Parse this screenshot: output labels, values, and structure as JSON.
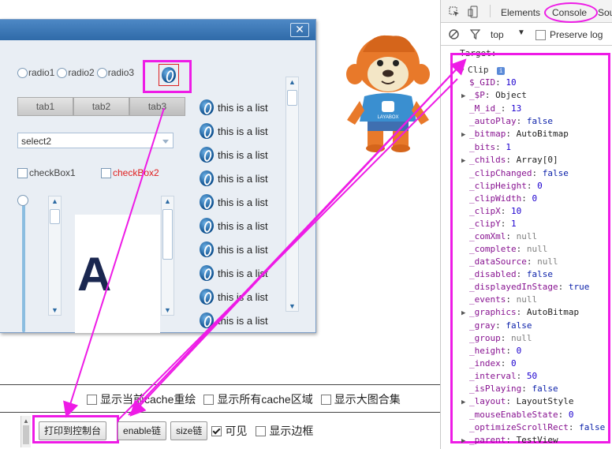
{
  "window": {
    "close_label": "✕"
  },
  "radios": [
    "radio1",
    "radio2",
    "radio3"
  ],
  "tabs": [
    "tab1",
    "tab2",
    "tab3"
  ],
  "select": {
    "value": "select2"
  },
  "checkboxes": [
    "checkBox1",
    "checkBox2"
  ],
  "list_items": [
    "this is a list",
    "this is a list",
    "this is a list",
    "this is a list",
    "this is a list",
    "this is a list",
    "this is a list",
    "this is a list",
    "this is a list",
    "this is a list"
  ],
  "image_letter": "A",
  "mascot": {
    "logo": "LAYABOX"
  },
  "options": {
    "show_current_cache": "显示当前cache重绘",
    "show_all_cache": "显示所有cache区域",
    "show_atlas": "显示大图合集"
  },
  "toolbar": {
    "print_label": "打印到控制台",
    "enable_label": "enable链",
    "size_label": "size链",
    "visible_label": "可见",
    "visible_checked": true,
    "border_label": "显示边框"
  },
  "devtools": {
    "tabs": [
      "Elements",
      "Console",
      "Sou"
    ],
    "context": "top",
    "preserve_log": "Preserve log",
    "target_label": "Target:",
    "object_name": "Clip",
    "properties": [
      {
        "k": "$_GID",
        "v": "10",
        "t": "num",
        "exp": false
      },
      {
        "k": "_$P",
        "v": "Object",
        "t": "obj",
        "exp": true
      },
      {
        "k": "_M_id_",
        "v": "13",
        "t": "num",
        "exp": false
      },
      {
        "k": "_autoPlay",
        "v": "false",
        "t": "bool",
        "exp": false
      },
      {
        "k": "_bitmap",
        "v": "AutoBitmap",
        "t": "obj",
        "exp": true
      },
      {
        "k": "_bits",
        "v": "1",
        "t": "num",
        "exp": false
      },
      {
        "k": "_childs",
        "v": "Array[0]",
        "t": "obj",
        "exp": true
      },
      {
        "k": "_clipChanged",
        "v": "false",
        "t": "bool",
        "exp": false
      },
      {
        "k": "_clipHeight",
        "v": "0",
        "t": "num",
        "exp": false
      },
      {
        "k": "_clipWidth",
        "v": "0",
        "t": "num",
        "exp": false
      },
      {
        "k": "_clipX",
        "v": "10",
        "t": "num",
        "exp": false
      },
      {
        "k": "_clipY",
        "v": "1",
        "t": "num",
        "exp": false
      },
      {
        "k": "_comXml",
        "v": "null",
        "t": "null",
        "exp": false
      },
      {
        "k": "_complete",
        "v": "null",
        "t": "null",
        "exp": false
      },
      {
        "k": "_dataSource",
        "v": "null",
        "t": "null",
        "exp": false
      },
      {
        "k": "_disabled",
        "v": "false",
        "t": "bool",
        "exp": false
      },
      {
        "k": "_displayedInStage",
        "v": "true",
        "t": "bool",
        "exp": false
      },
      {
        "k": "_events",
        "v": "null",
        "t": "null",
        "exp": false
      },
      {
        "k": "_graphics",
        "v": "AutoBitmap",
        "t": "obj",
        "exp": true
      },
      {
        "k": "_gray",
        "v": "false",
        "t": "bool",
        "exp": false
      },
      {
        "k": "_group",
        "v": "null",
        "t": "null",
        "exp": false
      },
      {
        "k": "_height",
        "v": "0",
        "t": "num",
        "exp": false
      },
      {
        "k": "_index",
        "v": "0",
        "t": "num",
        "exp": false
      },
      {
        "k": "_interval",
        "v": "50",
        "t": "num",
        "exp": false
      },
      {
        "k": "_isPlaying",
        "v": "false",
        "t": "bool",
        "exp": false
      },
      {
        "k": "_layout",
        "v": "LayoutStyle",
        "t": "obj",
        "exp": true
      },
      {
        "k": "_mouseEnableState",
        "v": "0",
        "t": "num",
        "exp": false
      },
      {
        "k": "_optimizeScrollRect",
        "v": "false",
        "t": "bool",
        "exp": false
      },
      {
        "k": "_parent",
        "v": "TestView",
        "t": "obj",
        "exp": true
      }
    ]
  },
  "colors": {
    "annotation": "#ee1be6",
    "title_bar": "#3a78b8"
  }
}
